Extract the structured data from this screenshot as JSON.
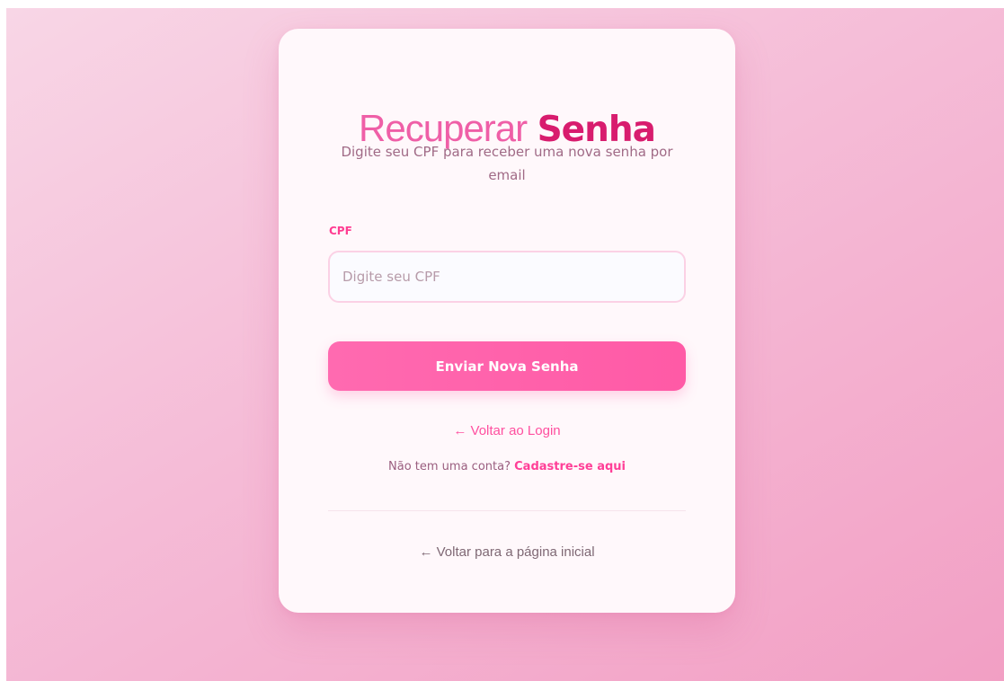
{
  "form": {
    "title_light": "Recuperar",
    "title_bold": "Senha",
    "subtitle": "Digite seu CPF para receber uma nova senha por email",
    "cpf_label": "CPF",
    "cpf_placeholder": "Digite seu CPF",
    "cpf_value": "",
    "submit_label": "Enviar Nova Senha",
    "back_to_login": "← Voltar ao Login",
    "no_account_text": "Não tem uma conta?",
    "signup_link": "Cadastre-se aqui",
    "back_to_home": "← Voltar para a página inicial"
  },
  "colors": {
    "accent": "#ff5aa6",
    "title_bold": "#d81c6e",
    "background_start": "#f8d6e6",
    "background_end": "#f29fc4"
  }
}
